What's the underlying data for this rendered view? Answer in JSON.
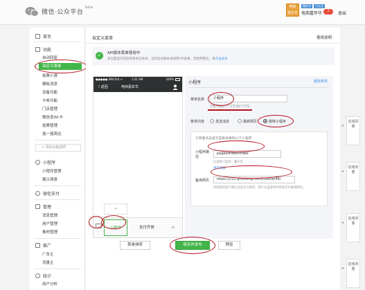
{
  "header": {
    "logo_text": "微信·公众平台",
    "logo_tag": "beta",
    "account_avatar_text": "电商\n嘉年华",
    "account_tags": [
      "服务号",
      "已认证"
    ],
    "account_name": "电商嘉年华",
    "message_badge": "7",
    "logout_label": "退出"
  },
  "sidebar": {
    "home": "首页",
    "sections": [
      {
        "title": "功能",
        "items": [
          "自动回复",
          "自定义菜单",
          "投票小游",
          "模板消息",
          "设备功能",
          "卡券功能",
          "门店管理",
          "微信连Wi-Fi",
          "投票管理",
          "摇一摇周边"
        ]
      },
      {
        "title": "小程序",
        "items": [
          "小程序管理",
          "展示场景"
        ]
      },
      {
        "title": "微信支付",
        "items": []
      },
      {
        "title": "管理",
        "items": [
          "消息管理",
          "用户管理",
          "素材管理"
        ]
      },
      {
        "title": "推广",
        "items": [
          "广告主",
          "流量主"
        ]
      },
      {
        "title": "统计",
        "items": [
          "用户分析"
        ]
      }
    ],
    "active_item": "自定义菜单",
    "add_plugin": "+ 添加功能插件"
  },
  "main": {
    "breadcrumb": "自定义菜单",
    "help_link": "使用说明",
    "notice_title": "API版本菜单使用中",
    "notice_desc": "该页面显示的菜单版本已失效。当前生效版本请调用API查看。若使用网页，请",
    "notice_link": "点击此处"
  },
  "phone": {
    "signal": "●●●●● WeChat ᯤ",
    "time": "1:21 AM",
    "battery": "100%",
    "back": "〈 返回",
    "title": "电商嘉年华",
    "add_symbol": "+",
    "menu_tabs": [
      "小程序",
      "支付开放"
    ],
    "menu_add_symbol": "+"
  },
  "editor": {
    "panel_title": "小程序",
    "delete_link": "删除菜单",
    "name_label": "菜单名称",
    "name_value": "小程序",
    "name_hint": "字数不超过4个汉字或8个字母",
    "content_label": "菜单内容",
    "options": [
      "发送消息",
      "跳转网页",
      "跳转小程序"
    ],
    "selected_option": "跳转小程序",
    "sub_desc": "订阅者点击该子菜单会跳到以下小程序",
    "path_label": "小程序路径",
    "path_value": "pages/index/index",
    "path_hint": "已选择小程序：量子店",
    "reselect": "重新选择",
    "backup_label": "备用网页",
    "backup_value": "https://211.qinzheng.com/course/46/",
    "backup_hint": "旧版微信客户端无法支持小程序，用户点击菜单时将会打开备用网页。"
  },
  "buttons": {
    "sort": "菜单排序",
    "save": "保存并发布",
    "preview": "预览"
  },
  "feedback": {
    "label": "在线问答"
  },
  "colors": {
    "accent_green": "#44b549",
    "annotation_red": "#b5111b",
    "link_blue": "#459ae9",
    "phone_dark": "#2e3132"
  }
}
